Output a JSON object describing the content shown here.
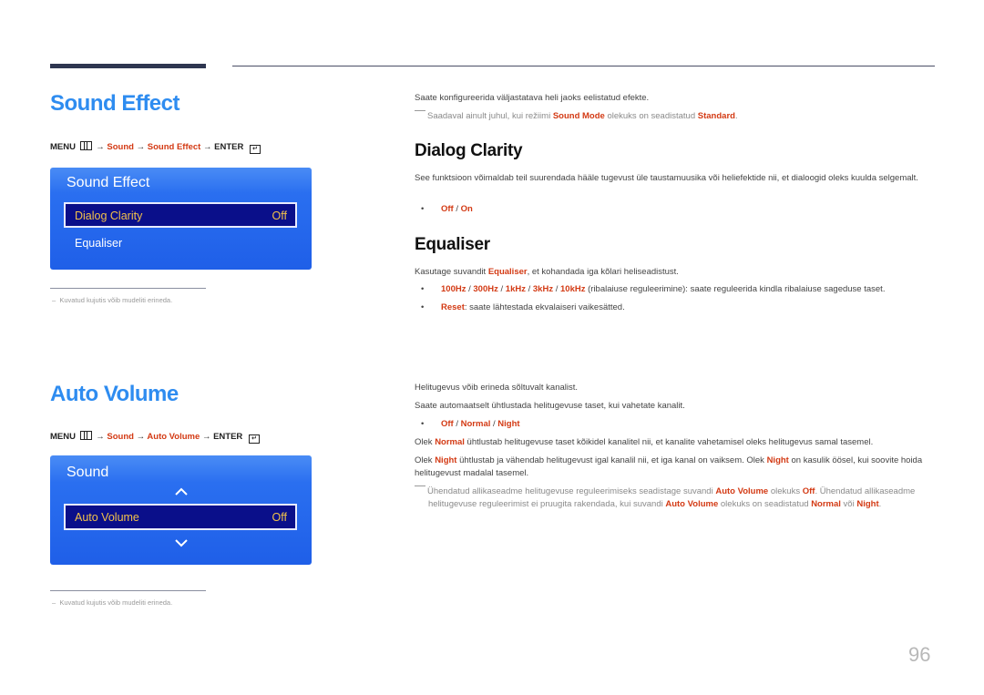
{
  "sections": {
    "sound_effect": {
      "title": "Sound Effect",
      "menu_path": {
        "menu": "MENU",
        "arrow": "→",
        "step1": "Sound",
        "step2": "Sound Effect",
        "enter": "ENTER"
      },
      "osd": {
        "title": "Sound Effect",
        "selected_label": "Dialog Clarity",
        "selected_value": "Off",
        "item2": "Equaliser"
      },
      "footnote": "Kuvatud kujutis võib mudeliti erineda.",
      "intro": "Saate konfigureerida väljastatava heli jaoks eelistatud efekte.",
      "note": {
        "pre": "Saadaval ainult juhul, kui režiimi ",
        "hl1": "Sound Mode",
        "mid": " olekuks on seadistatud ",
        "hl2": "Standard",
        "post": "."
      },
      "dialog_clarity": {
        "title": "Dialog Clarity",
        "text": "See funktsioon võimaldab teil suurendada hääle tugevust üle taustamuusika või heliefektide nii, et dialoogid oleks kuulda selgemalt.",
        "option1": "Off",
        "sep": " / ",
        "option2": "On"
      },
      "equaliser": {
        "title": "Equaliser",
        "text_pre": "Kasutage suvandit ",
        "text_hl": "Equaliser",
        "text_post": ", et kohandada iga kõlari heliseadistust.",
        "bands": [
          "100Hz",
          "300Hz",
          "1kHz",
          "3kHz",
          "10kHz"
        ],
        "bands_desc": " (ribalaiuse reguleerimine): saate reguleerida kindla ribalaiuse sageduse taset.",
        "reset_label": "Reset",
        "reset_desc": ": saate lähtestada ekvalaiseri vaikesätted."
      }
    },
    "auto_volume": {
      "title": "Auto Volume",
      "menu_path": {
        "menu": "MENU",
        "arrow": "→",
        "step1": "Sound",
        "step2": "Auto Volume",
        "enter": "ENTER"
      },
      "osd": {
        "title": "Sound",
        "selected_label": "Auto Volume",
        "selected_value": "Off"
      },
      "footnote": "Kuvatud kujutis võib mudeliti erineda.",
      "line1": "Helitugevus võib erineda sõltuvalt kanalist.",
      "line2": "Saate automaatselt ühtlustada helitugevuse taset, kui vahetate kanalit.",
      "options": [
        "Off",
        "Normal",
        "Night"
      ],
      "normal_para": {
        "pre": "Olek ",
        "hl": "Normal",
        "post": " ühtlustab helitugevuse taset kõikidel kanalitel nii, et kanalite vahetamisel oleks helitugevus samal tasemel."
      },
      "night_para": {
        "pre": "Olek ",
        "hl1": "Night",
        "mid": " ühtlustab ja vähendab helitugevust igal kanalil nii, et iga kanal on vaiksem. Olek ",
        "hl2": "Night",
        "post": " on kasulik öösel, kui soovite hoida helitugevust madalal tasemel."
      },
      "note": {
        "p1": "Ühendatud allikaseadme helitugevuse reguleerimiseks seadistage suvandi ",
        "h1": "Auto Volume",
        "p2": " olekuks ",
        "h2": "Off",
        "p3": ". Ühendatud allikaseadme helitugevuse reguleerimist ei pruugita rakendada, kui suvandi ",
        "h3": "Auto Volume",
        "p4": " olekuks on seadistatud ",
        "h4": "Normal",
        "p5": " või ",
        "h5": "Night",
        "p6": "."
      }
    }
  },
  "page_number": "96"
}
